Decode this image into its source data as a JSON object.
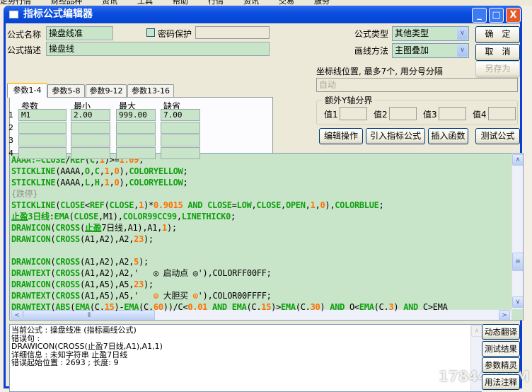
{
  "background_menu": [
    "走势行情",
    "财经品种",
    "资讯",
    "工具",
    "帮助",
    "行情",
    "资讯",
    "交易",
    "服务"
  ],
  "window": {
    "title": "指标公式编辑器",
    "minimize": "_",
    "maximize": "□",
    "close": "X"
  },
  "form": {
    "name_label": "公式名称",
    "name_value": "操盘线准",
    "password_label": "密码保护",
    "password_checked": false,
    "password_value": "",
    "desc_label": "公式描述",
    "desc_value": "操盘线",
    "type_label": "公式类型",
    "type_value": "其他类型",
    "draw_label": "画线方法",
    "draw_value": "主图叠加"
  },
  "buttons": {
    "ok": "确　定",
    "cancel": "取　消",
    "save_as": "另存为",
    "edit_ops": "编辑操作",
    "import": "引入指标公式",
    "insert_fn": "插入函数",
    "test": "测试公式"
  },
  "tabs": [
    {
      "label": "参数1-4",
      "active": true
    },
    {
      "label": "参数5-8"
    },
    {
      "label": "参数9-12"
    },
    {
      "label": "参数13-16"
    }
  ],
  "params": {
    "headers": [
      "参数",
      "最小",
      "最大",
      "缺省"
    ],
    "rows": [
      {
        "n": "1",
        "cells": [
          "M1",
          "2.00",
          "999.00",
          "7.00"
        ]
      },
      {
        "n": "2",
        "cells": [
          "",
          "",
          "",
          ""
        ]
      },
      {
        "n": "3",
        "cells": [
          "",
          "",
          "",
          ""
        ]
      },
      {
        "n": "4",
        "cells": [
          "",
          "",
          "",
          ""
        ]
      }
    ]
  },
  "axis": {
    "label": "坐标线位置, 最多7个, 用分号分隔",
    "value": "自动"
  },
  "extra_y": {
    "legend": "额外Y轴分界",
    "fields": [
      {
        "label": "值1",
        "value": ""
      },
      {
        "label": "值2",
        "value": ""
      },
      {
        "label": "值3",
        "value": ""
      },
      {
        "label": "值4",
        "value": ""
      }
    ]
  },
  "code_lines": [
    [
      [
        "AAAA:=",
        "g"
      ],
      [
        "CLOSE",
        "g"
      ],
      [
        "/",
        "k"
      ],
      [
        "REF",
        "g"
      ],
      [
        "(",
        "k"
      ],
      [
        "C",
        "g"
      ],
      [
        ",",
        "k"
      ],
      [
        "1",
        "o"
      ],
      [
        ")>=",
        "k"
      ],
      [
        "1.09",
        "o"
      ],
      [
        ";",
        "k"
      ]
    ],
    [
      [
        "STICKLINE",
        "g"
      ],
      [
        "(AAAA,",
        "k"
      ],
      [
        "O",
        "g"
      ],
      [
        ",",
        "k"
      ],
      [
        "C",
        "g"
      ],
      [
        ",",
        "k"
      ],
      [
        "1",
        "o"
      ],
      [
        ",",
        "k"
      ],
      [
        "0",
        "o"
      ],
      [
        "),",
        "k"
      ],
      [
        "COLORYELLOW",
        "g"
      ],
      [
        ";",
        "k"
      ]
    ],
    [
      [
        "STICKLINE",
        "g"
      ],
      [
        "(AAAA,",
        "k"
      ],
      [
        "L",
        "g"
      ],
      [
        ",",
        "k"
      ],
      [
        "H",
        "g"
      ],
      [
        ",",
        "k"
      ],
      [
        "1",
        "o"
      ],
      [
        ",",
        "k"
      ],
      [
        "0",
        "o"
      ],
      [
        "),",
        "k"
      ],
      [
        "COLORYELLOW",
        "g"
      ],
      [
        ";",
        "k"
      ]
    ],
    [
      [
        "{跌停}",
        "c"
      ]
    ],
    [
      [
        "STICKLINE",
        "g"
      ],
      [
        "(",
        "k"
      ],
      [
        "CLOSE",
        "g"
      ],
      [
        "<",
        "k"
      ],
      [
        "REF",
        "g"
      ],
      [
        "(",
        "k"
      ],
      [
        "CLOSE",
        "g"
      ],
      [
        ",",
        "k"
      ],
      [
        "1",
        "o"
      ],
      [
        ")*",
        "k"
      ],
      [
        "0.9015",
        "o"
      ],
      [
        " AND ",
        "g"
      ],
      [
        "CLOSE",
        "g"
      ],
      [
        "=",
        "k"
      ],
      [
        "LOW",
        "g"
      ],
      [
        ",",
        "k"
      ],
      [
        "CLOSE",
        "g"
      ],
      [
        ",",
        "k"
      ],
      [
        "OPEN",
        "g"
      ],
      [
        ",",
        "k"
      ],
      [
        "1",
        "o"
      ],
      [
        ",",
        "k"
      ],
      [
        "0",
        "o"
      ],
      [
        "),",
        "k"
      ],
      [
        "COLORBLUE",
        "g"
      ],
      [
        ";",
        "k"
      ]
    ],
    [
      [
        "止盈",
        "u"
      ],
      [
        "3日线",
        "g"
      ],
      [
        ":",
        "k"
      ],
      [
        "EMA",
        "g"
      ],
      [
        "(",
        "k"
      ],
      [
        "CLOSE",
        "g"
      ],
      [
        ",M1),",
        "k"
      ],
      [
        "COLOR99CC99",
        "g"
      ],
      [
        ",",
        "k"
      ],
      [
        "LINETHICK0",
        "g"
      ],
      [
        ";",
        "k"
      ]
    ],
    [
      [
        "DRAWICON",
        "g"
      ],
      [
        "(",
        "k"
      ],
      [
        "CROSS",
        "g"
      ],
      [
        "(",
        "k"
      ],
      [
        "止盈",
        "u"
      ],
      [
        "7日线",
        "k"
      ],
      [
        ",A1),A1,",
        "k"
      ],
      [
        "1",
        "o"
      ],
      [
        ");",
        "k"
      ]
    ],
    [
      [
        "DRAWICON",
        "g"
      ],
      [
        "(",
        "k"
      ],
      [
        "CROSS",
        "g"
      ],
      [
        "(A1,A2),A2,",
        "k"
      ],
      [
        "23",
        "o"
      ],
      [
        ");",
        "k"
      ]
    ],
    [
      [
        "",
        "k"
      ]
    ],
    [
      [
        "DRAWICON",
        "g"
      ],
      [
        "(",
        "k"
      ],
      [
        "CROSS",
        "g"
      ],
      [
        "(A1,A2),A2,",
        "k"
      ],
      [
        "5",
        "o"
      ],
      [
        ");",
        "k"
      ]
    ],
    [
      [
        "DRAWTEXT",
        "g"
      ],
      [
        "(",
        "k"
      ],
      [
        "CROSS",
        "g"
      ],
      [
        "(A1,A2),A2,'   ◎ 启动点 ◎'),",
        "k"
      ],
      [
        "COLORFF00FF",
        "k"
      ],
      [
        ";",
        "k"
      ]
    ],
    [
      [
        "DRAWICON",
        "g"
      ],
      [
        "(",
        "k"
      ],
      [
        "CROSS",
        "g"
      ],
      [
        "(A1,A5),A5,",
        "k"
      ],
      [
        "23",
        "o"
      ],
      [
        ");",
        "k"
      ]
    ],
    [
      [
        "DRAWTEXT",
        "g"
      ],
      [
        "(",
        "k"
      ],
      [
        "CROSS",
        "g"
      ],
      [
        "(A1,A5),A5,'   ",
        "k"
      ],
      [
        "⊙",
        "o"
      ],
      [
        " 大胆买 ",
        "k"
      ],
      [
        "⊙",
        "o"
      ],
      [
        "'),",
        "k"
      ],
      [
        "COLOR00FFFF",
        "k"
      ],
      [
        ";",
        "k"
      ]
    ],
    [
      [
        "DRAWTEXT",
        "g"
      ],
      [
        "(",
        "k"
      ],
      [
        "ABS",
        "g"
      ],
      [
        "(",
        "k"
      ],
      [
        "EMA",
        "g"
      ],
      [
        "(C.",
        "k"
      ],
      [
        "15",
        "o"
      ],
      [
        ")-",
        "k"
      ],
      [
        "EMA",
        "g"
      ],
      [
        "(C.",
        "k"
      ],
      [
        "60",
        "o"
      ],
      [
        "))/C<",
        "k"
      ],
      [
        "0.01",
        "o"
      ],
      [
        " AND ",
        "g"
      ],
      [
        "EMA",
        "g"
      ],
      [
        "(C.",
        "k"
      ],
      [
        "15",
        "o"
      ],
      [
        ")>",
        "k"
      ],
      [
        "EMA",
        "g"
      ],
      [
        "(C.",
        "k"
      ],
      [
        "30",
        "o"
      ],
      [
        ")",
        "k"
      ],
      [
        " AND ",
        "g"
      ],
      [
        "O<",
        "k"
      ],
      [
        "EMA",
        "g"
      ],
      [
        "(C.",
        "k"
      ],
      [
        "3",
        "o"
      ],
      [
        ")",
        "k"
      ],
      [
        " AND ",
        "g"
      ],
      [
        "C>EMA",
        "k"
      ]
    ]
  ],
  "messages": [
    "当前公式 : 操盘线准 (指标画线公式)",
    "错误句 :",
    "DRAWICON(CROSS(止盈7日线,A1),A1,1)",
    "详细信息 : 未知字符串 止盈7日线",
    "错误起始位置 : 2693 ; 长度: 9"
  ],
  "side_buttons": [
    "动态翻译",
    "测试结果",
    "参数精灵",
    "用法注释"
  ],
  "watermark": "17844.COM",
  "colors": {
    "title_bar": "#0a4ee0",
    "field_bg": "#c9e5c9",
    "keyword": "#10a010",
    "number": "#ff7000"
  }
}
